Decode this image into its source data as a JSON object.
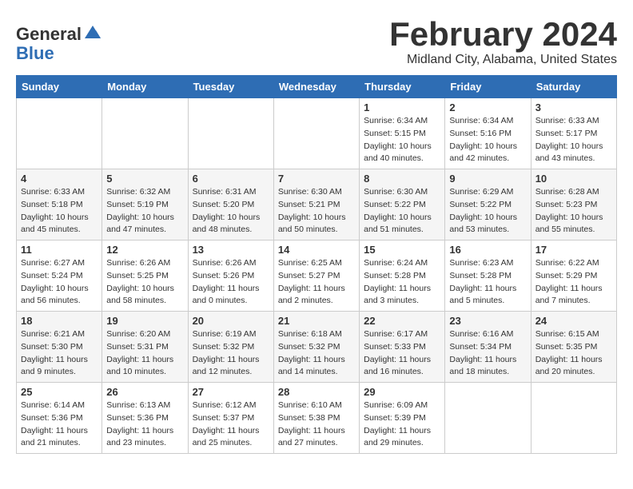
{
  "header": {
    "logo_line1": "General",
    "logo_line2": "Blue",
    "title": "February 2024",
    "subtitle": "Midland City, Alabama, United States"
  },
  "weekdays": [
    "Sunday",
    "Monday",
    "Tuesday",
    "Wednesday",
    "Thursday",
    "Friday",
    "Saturday"
  ],
  "weeks": [
    [
      {
        "date": "",
        "info": ""
      },
      {
        "date": "",
        "info": ""
      },
      {
        "date": "",
        "info": ""
      },
      {
        "date": "",
        "info": ""
      },
      {
        "date": "1",
        "info": "Sunrise: 6:34 AM\nSunset: 5:15 PM\nDaylight: 10 hours\nand 40 minutes."
      },
      {
        "date": "2",
        "info": "Sunrise: 6:34 AM\nSunset: 5:16 PM\nDaylight: 10 hours\nand 42 minutes."
      },
      {
        "date": "3",
        "info": "Sunrise: 6:33 AM\nSunset: 5:17 PM\nDaylight: 10 hours\nand 43 minutes."
      }
    ],
    [
      {
        "date": "4",
        "info": "Sunrise: 6:33 AM\nSunset: 5:18 PM\nDaylight: 10 hours\nand 45 minutes."
      },
      {
        "date": "5",
        "info": "Sunrise: 6:32 AM\nSunset: 5:19 PM\nDaylight: 10 hours\nand 47 minutes."
      },
      {
        "date": "6",
        "info": "Sunrise: 6:31 AM\nSunset: 5:20 PM\nDaylight: 10 hours\nand 48 minutes."
      },
      {
        "date": "7",
        "info": "Sunrise: 6:30 AM\nSunset: 5:21 PM\nDaylight: 10 hours\nand 50 minutes."
      },
      {
        "date": "8",
        "info": "Sunrise: 6:30 AM\nSunset: 5:22 PM\nDaylight: 10 hours\nand 51 minutes."
      },
      {
        "date": "9",
        "info": "Sunrise: 6:29 AM\nSunset: 5:22 PM\nDaylight: 10 hours\nand 53 minutes."
      },
      {
        "date": "10",
        "info": "Sunrise: 6:28 AM\nSunset: 5:23 PM\nDaylight: 10 hours\nand 55 minutes."
      }
    ],
    [
      {
        "date": "11",
        "info": "Sunrise: 6:27 AM\nSunset: 5:24 PM\nDaylight: 10 hours\nand 56 minutes."
      },
      {
        "date": "12",
        "info": "Sunrise: 6:26 AM\nSunset: 5:25 PM\nDaylight: 10 hours\nand 58 minutes."
      },
      {
        "date": "13",
        "info": "Sunrise: 6:26 AM\nSunset: 5:26 PM\nDaylight: 11 hours\nand 0 minutes."
      },
      {
        "date": "14",
        "info": "Sunrise: 6:25 AM\nSunset: 5:27 PM\nDaylight: 11 hours\nand 2 minutes."
      },
      {
        "date": "15",
        "info": "Sunrise: 6:24 AM\nSunset: 5:28 PM\nDaylight: 11 hours\nand 3 minutes."
      },
      {
        "date": "16",
        "info": "Sunrise: 6:23 AM\nSunset: 5:28 PM\nDaylight: 11 hours\nand 5 minutes."
      },
      {
        "date": "17",
        "info": "Sunrise: 6:22 AM\nSunset: 5:29 PM\nDaylight: 11 hours\nand 7 minutes."
      }
    ],
    [
      {
        "date": "18",
        "info": "Sunrise: 6:21 AM\nSunset: 5:30 PM\nDaylight: 11 hours\nand 9 minutes."
      },
      {
        "date": "19",
        "info": "Sunrise: 6:20 AM\nSunset: 5:31 PM\nDaylight: 11 hours\nand 10 minutes."
      },
      {
        "date": "20",
        "info": "Sunrise: 6:19 AM\nSunset: 5:32 PM\nDaylight: 11 hours\nand 12 minutes."
      },
      {
        "date": "21",
        "info": "Sunrise: 6:18 AM\nSunset: 5:32 PM\nDaylight: 11 hours\nand 14 minutes."
      },
      {
        "date": "22",
        "info": "Sunrise: 6:17 AM\nSunset: 5:33 PM\nDaylight: 11 hours\nand 16 minutes."
      },
      {
        "date": "23",
        "info": "Sunrise: 6:16 AM\nSunset: 5:34 PM\nDaylight: 11 hours\nand 18 minutes."
      },
      {
        "date": "24",
        "info": "Sunrise: 6:15 AM\nSunset: 5:35 PM\nDaylight: 11 hours\nand 20 minutes."
      }
    ],
    [
      {
        "date": "25",
        "info": "Sunrise: 6:14 AM\nSunset: 5:36 PM\nDaylight: 11 hours\nand 21 minutes."
      },
      {
        "date": "26",
        "info": "Sunrise: 6:13 AM\nSunset: 5:36 PM\nDaylight: 11 hours\nand 23 minutes."
      },
      {
        "date": "27",
        "info": "Sunrise: 6:12 AM\nSunset: 5:37 PM\nDaylight: 11 hours\nand 25 minutes."
      },
      {
        "date": "28",
        "info": "Sunrise: 6:10 AM\nSunset: 5:38 PM\nDaylight: 11 hours\nand 27 minutes."
      },
      {
        "date": "29",
        "info": "Sunrise: 6:09 AM\nSunset: 5:39 PM\nDaylight: 11 hours\nand 29 minutes."
      },
      {
        "date": "",
        "info": ""
      },
      {
        "date": "",
        "info": ""
      }
    ]
  ]
}
